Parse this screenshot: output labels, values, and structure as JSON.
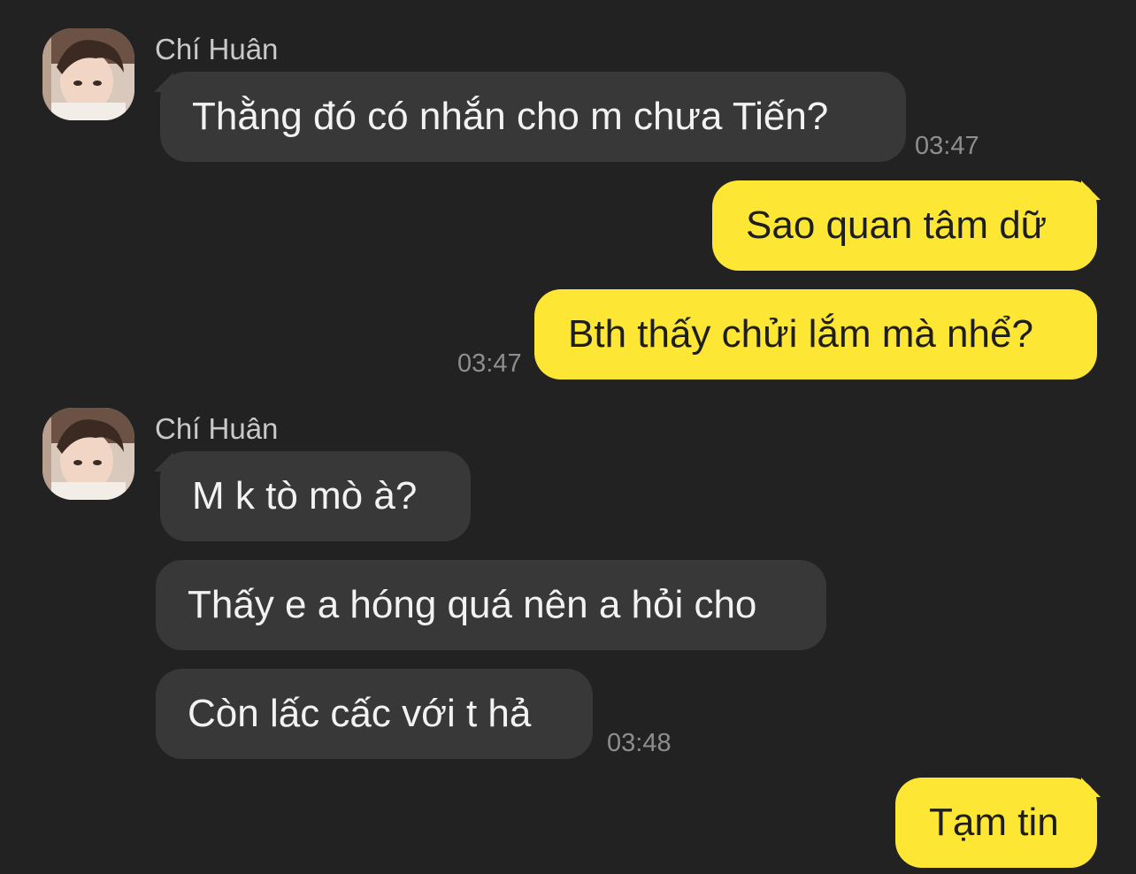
{
  "colors": {
    "background": "#222222",
    "incoming_bubble": "#383838",
    "outgoing_bubble": "#fde734",
    "incoming_text": "#f2f2f2",
    "outgoing_text": "#1e1e1e",
    "timestamp": "#8e8e8e",
    "sender_name": "#c9c9c9"
  },
  "groups": [
    {
      "sender": "Chí Huân",
      "messages": [
        {
          "text": "Thằng đó có nhắn cho m chưa Tiến?",
          "time": "03:47"
        }
      ]
    },
    {
      "sender": "me",
      "messages": [
        {
          "text": "Sao quan tâm dữ"
        },
        {
          "text": "Bth thấy chửi lắm mà nhể?",
          "time": "03:47"
        }
      ]
    },
    {
      "sender": "Chí Huân",
      "messages": [
        {
          "text": "M k tò mò à?"
        },
        {
          "text": "Thấy e a hóng quá nên a hỏi cho"
        },
        {
          "text": "Còn lấc cấc với t hả",
          "time": "03:48"
        }
      ]
    },
    {
      "sender": "me",
      "messages": [
        {
          "text": "Tạm tin"
        }
      ]
    }
  ],
  "icons": {
    "avatar": "contact-avatar-photo"
  }
}
